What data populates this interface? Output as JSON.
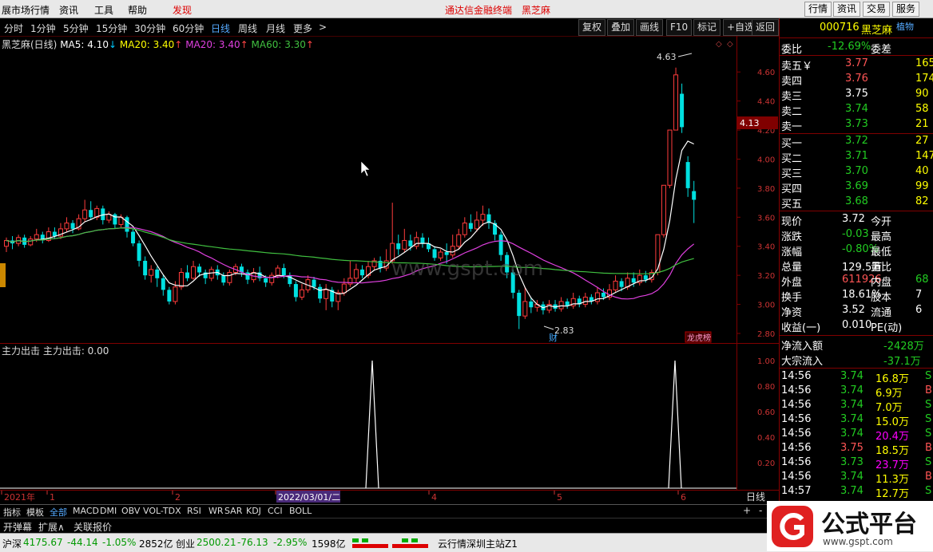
{
  "menu": {
    "items": [
      "展市场行情",
      "资讯",
      "工具",
      "帮助"
    ],
    "discover": "发现",
    "center_title": "通达信金融终端",
    "stock_name": "黑芝麻",
    "right_buttons": [
      "行情",
      "资讯",
      "交易",
      "服务"
    ]
  },
  "periods": [
    "分时",
    "1分钟",
    "5分钟",
    "15分钟",
    "30分钟",
    "60分钟",
    "日线",
    "周线",
    "月线",
    "更多"
  ],
  "active_period": "日线",
  "more_arrow": ">",
  "toolbar": [
    "复权",
    "叠加",
    "画线",
    "F10",
    "标记",
    "+自选",
    "返回"
  ],
  "legend": {
    "title": "黑芝麻(日线)",
    "ma5": "MA5: 4.10",
    "ma5_arrow": "↓",
    "ma20a": "MA20: 3.40",
    "ma20a_arrow": "↑",
    "ma20b": "MA20: 3.40",
    "ma20b_arrow": "↑",
    "ma60": "MA60: 3.30",
    "ma60_arrow": "↑"
  },
  "colors": {
    "up": "#ff3c3c",
    "down": "#00e0e0",
    "ma5": "#ffffff",
    "ma20": "#e040e0",
    "ma60": "#40c040",
    "axis": "#800000"
  },
  "chart_data": {
    "type": "candlestick",
    "ylim": [
      2.8,
      4.7
    ],
    "yticks": [
      "4.60",
      "4.40",
      "4.20",
      "4.00",
      "3.80",
      "3.60",
      "3.40",
      "3.20",
      "3.00",
      "2.80"
    ],
    "current_price_tag": "4.13",
    "high_label": "4.63",
    "low_label": "2.83",
    "badge_cai": "财",
    "badge_longhu": "龙虎榜",
    "lower_panel": {
      "title": "主力出击  主力出击: 0.00",
      "yticks": [
        "1.00",
        "0.80",
        "0.60",
        "0.40",
        "0.20"
      ],
      "spikes": [
        "2022-03-03",
        "2022-06-01"
      ]
    },
    "x_labels": [
      "2021年",
      "1",
      "2",
      "2022/03/01/二",
      "4",
      "5",
      "6"
    ],
    "period_label": "日线"
  },
  "quote": {
    "code": "000716",
    "name": "黑芝麻",
    "tag": "植物",
    "webi_label": "委比",
    "webi_value": "-12.69%",
    "weicha_label": "委差",
    "asks": [
      {
        "label": "卖五",
        "mark": "￥",
        "price": "3.77",
        "vol": "165"
      },
      {
        "label": "卖四",
        "mark": "",
        "price": "3.76",
        "vol": "174"
      },
      {
        "label": "卖三",
        "mark": "",
        "price": "3.75",
        "vol": "90"
      },
      {
        "label": "卖二",
        "mark": "",
        "price": "3.74",
        "vol": "58"
      },
      {
        "label": "卖一",
        "mark": "",
        "price": "3.73",
        "vol": "21"
      }
    ],
    "bids": [
      {
        "label": "买一",
        "price": "3.72",
        "vol": "27"
      },
      {
        "label": "买二",
        "price": "3.71",
        "vol": "147"
      },
      {
        "label": "买三",
        "price": "3.70",
        "vol": "40"
      },
      {
        "label": "买四",
        "price": "3.69",
        "vol": "99"
      },
      {
        "label": "买五",
        "price": "3.68",
        "vol": "82"
      }
    ],
    "stats": [
      {
        "l1": "现价",
        "v1": "3.72",
        "l2": "今开"
      },
      {
        "l1": "涨跌",
        "v1": "-0.03",
        "l2": "最高"
      },
      {
        "l1": "涨幅",
        "v1": "-0.80%",
        "l2": "最低"
      },
      {
        "l1": "总量",
        "v1": "129.5万",
        "l2": "量比"
      },
      {
        "l1": "外盘",
        "v1": "611926",
        "l2": "内盘",
        "v2": "68"
      },
      {
        "l1": "换手",
        "v1": "18.61%",
        "l2": "股本",
        "v2": "7"
      },
      {
        "l1": "净资",
        "v1": "3.52",
        "l2": "流通",
        "v2": "6"
      },
      {
        "l1": "收益(一)",
        "v1": "0.010",
        "l2": "PE(动)"
      }
    ],
    "flow": [
      {
        "label": "净流入额",
        "value": "-2428万"
      },
      {
        "label": "大宗流入",
        "value": "-37.1万"
      }
    ],
    "ticks": [
      {
        "time": "14:56",
        "price": "3.74",
        "vol": "16.8万",
        "bs": "S"
      },
      {
        "time": "14:56",
        "price": "3.74",
        "vol": "6.9万",
        "bs": "B"
      },
      {
        "time": "14:56",
        "price": "3.74",
        "vol": "7.0万",
        "bs": "S"
      },
      {
        "time": "14:56",
        "price": "3.74",
        "vol": "15.0万",
        "bs": "S"
      },
      {
        "time": "14:56",
        "price": "3.74",
        "vol": "20.4万",
        "bs": "S"
      },
      {
        "time": "14:56",
        "price": "3.75",
        "vol": "18.5万",
        "bs": "B"
      },
      {
        "time": "14:56",
        "price": "3.73",
        "vol": "23.7万",
        "bs": "S"
      },
      {
        "time": "14:56",
        "price": "3.74",
        "vol": "11.3万",
        "bs": "B"
      },
      {
        "time": "14:57",
        "price": "3.74",
        "vol": "12.7万",
        "bs": "S"
      }
    ]
  },
  "indicator_tabs": [
    "指标",
    "模板",
    "全部",
    "MACD",
    "DMI",
    "OBV",
    "VOL-TDX",
    "RSI",
    "WR",
    "SAR",
    "KDJ",
    "CCI",
    "BOLL"
  ],
  "bottom_buttons": [
    "开弹幕",
    "扩展∧",
    "关联报价"
  ],
  "zoom": [
    "+",
    "-"
  ],
  "status": {
    "sh_label": "沪深",
    "sh_value": "4175.67",
    "sh_change": "-44.14",
    "sh_pct": "-1.05%",
    "sh_amount": "2852亿",
    "cy_label": "创业",
    "cy_value": "2500.21",
    "cy_change": "-76.13",
    "cy_pct": "-2.95%",
    "cy_amount": "1598亿",
    "server": "云行情深圳主站Z1"
  },
  "logo": {
    "text": "公式平台",
    "url": "www.gspt.com"
  },
  "watermark": "www.gspt.com"
}
